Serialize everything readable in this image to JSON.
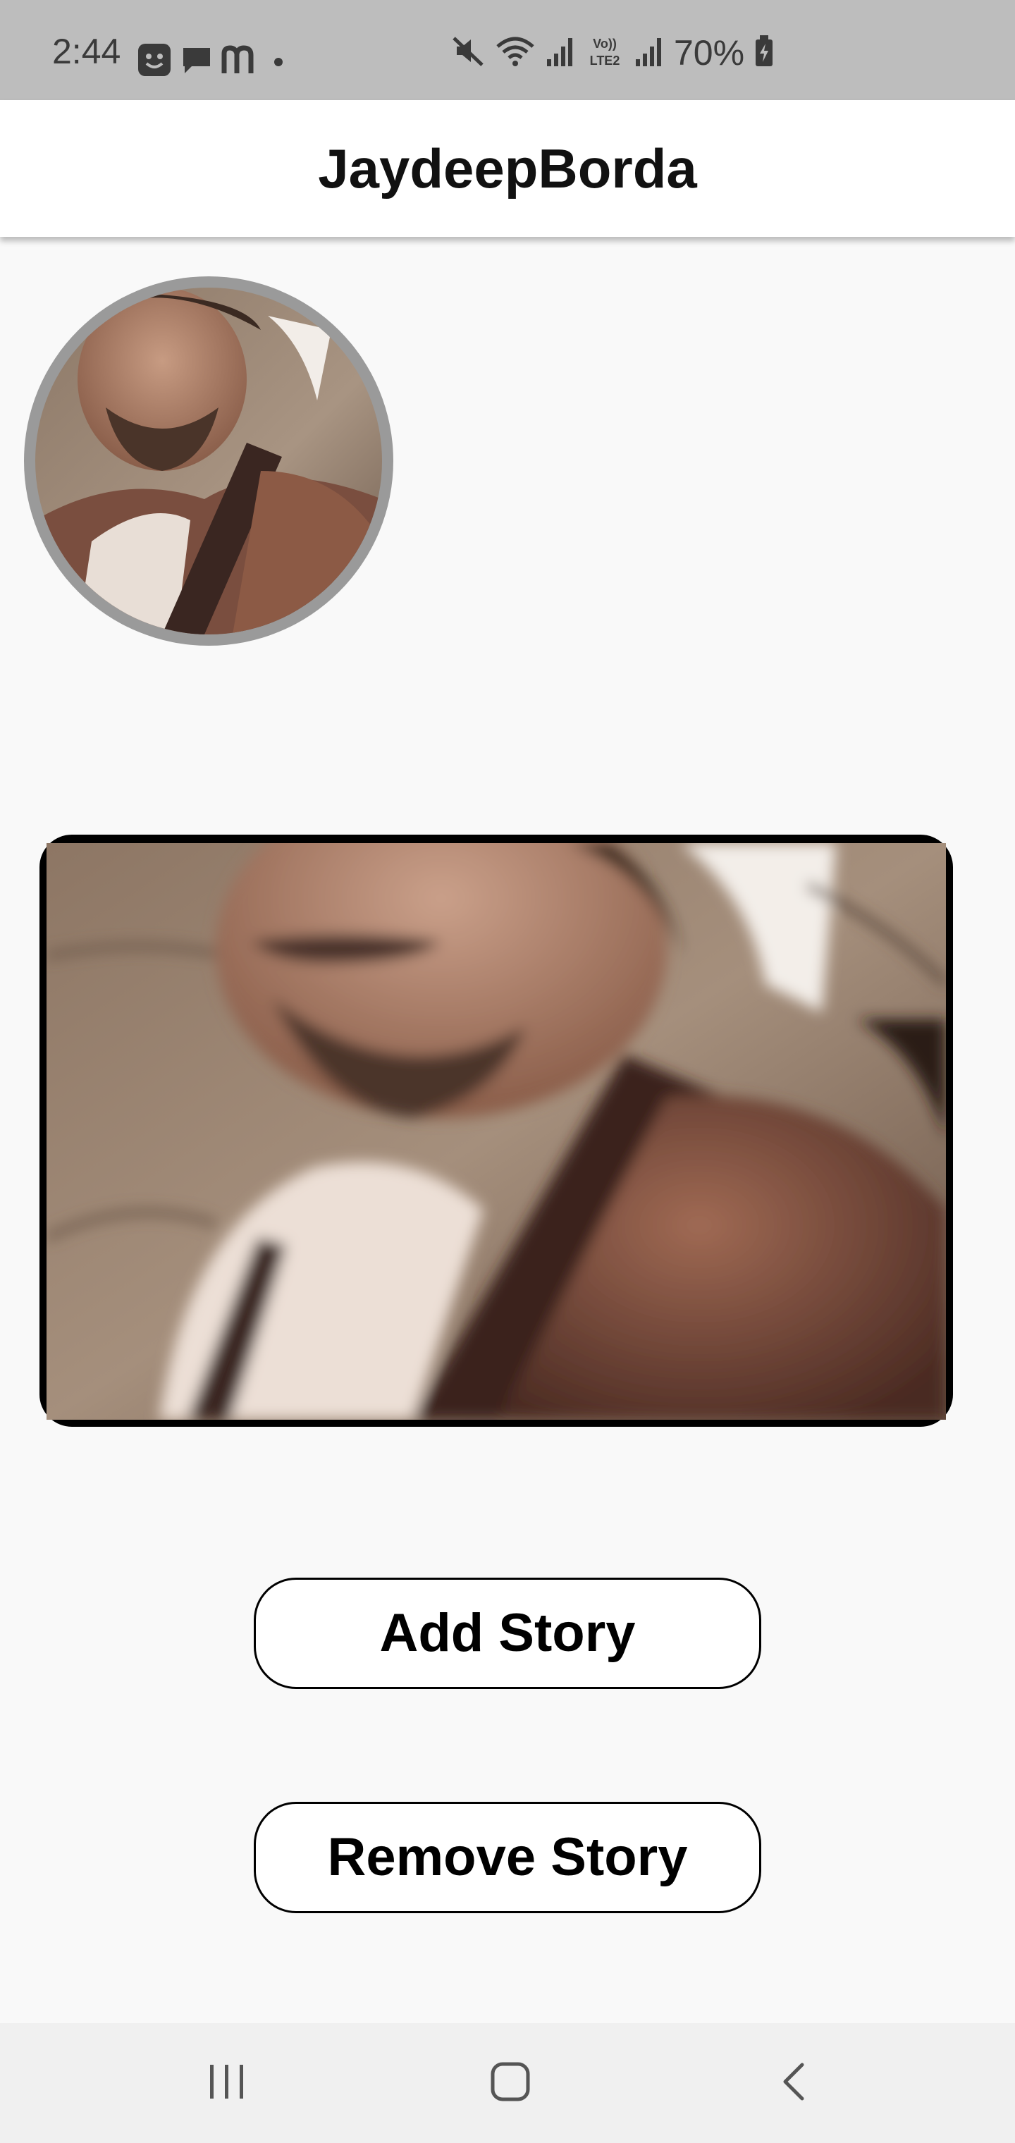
{
  "status_bar": {
    "time": "2:44",
    "battery": "70%",
    "left_icons": [
      "face-notification-icon",
      "chat-bubble-icon",
      "m-app-icon",
      "dot-icon"
    ],
    "right_icons": [
      "mute-icon",
      "wifi-icon",
      "signal-icon",
      "volte-icon",
      "signal-icon",
      "battery-charging-icon"
    ]
  },
  "app_bar": {
    "title": "JaydeepBorda"
  },
  "profile": {
    "avatar_icon": "profile-photo"
  },
  "story": {
    "image_icon": "story-photo"
  },
  "actions": {
    "add_story_label": "Add Story",
    "remove_story_label": "Remove Story"
  },
  "nav_bar": {
    "items": [
      "recent-apps-icon",
      "home-icon",
      "back-icon"
    ]
  },
  "colors": {
    "status_bar_bg": "#bdbdbd",
    "page_bg": "#f9f9f9",
    "avatar_ring": "#9a9a9a",
    "story_border": "#000000",
    "button_border": "#000000"
  }
}
